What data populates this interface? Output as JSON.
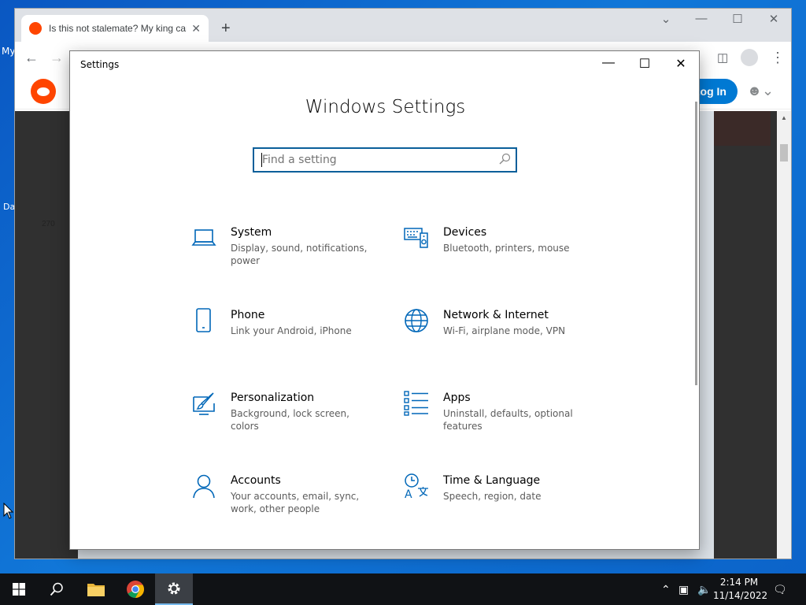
{
  "desktop": {
    "icon_labels": [
      "My",
      "Da"
    ]
  },
  "browser": {
    "tab_title": "Is this not stalemate? My king can't move",
    "tab_close": "✕",
    "new_tab": "+",
    "reddit": {
      "login_label": "Log In",
      "vote_count": "270"
    }
  },
  "settings": {
    "window_title": "Settings",
    "heading": "Windows Settings",
    "search_placeholder": "Find a setting",
    "items": [
      {
        "name": "System",
        "desc": "Display, sound, notifications, power",
        "icon": "laptop-icon"
      },
      {
        "name": "Devices",
        "desc": "Bluetooth, printers, mouse",
        "icon": "keyboard-speaker-icon"
      },
      {
        "name": "Phone",
        "desc": "Link your Android, iPhone",
        "icon": "phone-icon"
      },
      {
        "name": "Network & Internet",
        "desc": "Wi-Fi, airplane mode, VPN",
        "icon": "globe-icon"
      },
      {
        "name": "Personalization",
        "desc": "Background, lock screen, colors",
        "icon": "paintbrush-icon"
      },
      {
        "name": "Apps",
        "desc": "Uninstall, defaults, optional features",
        "icon": "apps-list-icon"
      },
      {
        "name": "Accounts",
        "desc": "Your accounts, email, sync, work, other people",
        "icon": "person-icon"
      },
      {
        "name": "Time & Language",
        "desc": "Speech, region, date",
        "icon": "time-language-icon"
      }
    ],
    "accent_color": "#0067b8"
  },
  "taskbar": {
    "time": "2:14 PM",
    "date": "11/14/2022"
  }
}
